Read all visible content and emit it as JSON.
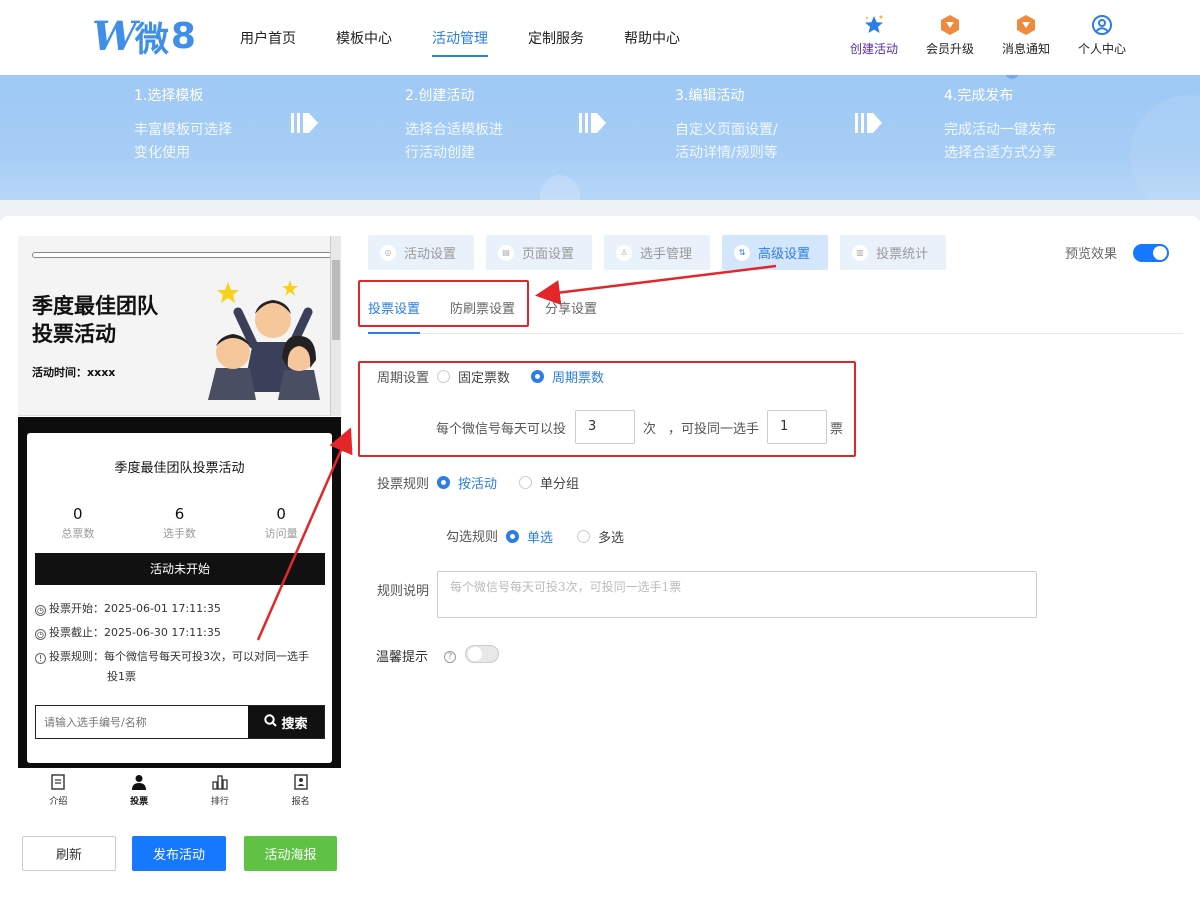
{
  "nav": {
    "logo_w": "W",
    "logo_wei": "微",
    "logo_eight": "8",
    "menu": [
      "用户首页",
      "模板中心",
      "活动管理",
      "定制服务",
      "帮助中心"
    ],
    "active_menu": "活动管理",
    "tools": [
      {
        "label": "创建活动",
        "icon": "star-icon"
      },
      {
        "label": "会员升级",
        "icon": "vip-badge-icon"
      },
      {
        "label": "消息通知",
        "icon": "notification-badge-icon"
      },
      {
        "label": "个人中心",
        "icon": "user-icon"
      }
    ]
  },
  "steps": [
    {
      "title": "1.选择模板",
      "line1": "丰富模板可选择",
      "line2": "变化使用"
    },
    {
      "title": "2.创建活动",
      "line1": "选择合适模板进",
      "line2": "行活动创建"
    },
    {
      "title": "3.编辑活动",
      "line1": "自定义页面设置/",
      "line2": "活动详情/规则等"
    },
    {
      "title": "4.完成发布",
      "line1": "完成活动一键发布",
      "line2": "选择合适方式分享"
    }
  ],
  "phone": {
    "title": "季度最佳团队投票活动",
    "title_line1": "季度最佳团队",
    "title_line2": "投票活动",
    "time_label": "活动时间：xxxx",
    "panel_title": "季度最佳团队投票活动",
    "stats": [
      {
        "value": "0",
        "label": "总票数"
      },
      {
        "value": "6",
        "label": "选手数"
      },
      {
        "value": "0",
        "label": "访问量"
      }
    ],
    "status": "活动未开始",
    "vote_start": "投票开始：2025-06-01 17:11:35",
    "vote_end": "投票截止：2025-06-30 17:11:35",
    "vote_rule_line1": "投票规则：每个微信号每天可投3次，可以对同一选手",
    "vote_rule_line2": "投1票",
    "search_placeholder": "请输入选手编号/名称",
    "search_button": "搜索",
    "tabbar": [
      "介绍",
      "投票",
      "排行",
      "报名"
    ]
  },
  "actions": {
    "refresh": "刷新",
    "publish": "发布活动",
    "poster": "活动海报"
  },
  "main_tabs": [
    "活动设置",
    "页面设置",
    "选手管理",
    "高级设置",
    "投票统计"
  ],
  "active_main_tab": "高级设置",
  "preview": {
    "label": "预览效果",
    "enabled": true
  },
  "sub_tabs": [
    "投票设置",
    "防刷票设置",
    "分享设置"
  ],
  "active_sub_tab": "投票设置",
  "form": {
    "period_label": "周期设置",
    "period_options": [
      "固定票数",
      "周期票数"
    ],
    "period_selected": "周期票数",
    "per_day_prefix": "每个微信号每天可以投",
    "per_day_value": "3",
    "per_day_unit": "次",
    "same_player_prefix": "，可投同一选手",
    "same_player_value": "1",
    "same_player_unit": "票",
    "rule_label": "投票规则",
    "rule_options": [
      "按活动",
      "单分组"
    ],
    "rule_selected": "按活动",
    "check_label": "勾选规则",
    "check_options": [
      "单选",
      "多选"
    ],
    "check_selected": "单选",
    "desc_label": "规则说明",
    "desc_placeholder": "每个微信号每天可投3次，可投同一选手1票",
    "tip_label": "温馨提示",
    "tip_help": "?",
    "tip_enabled": false
  },
  "colors": {
    "accent": "#1677ff",
    "annotation": "#e3262a",
    "poster": "#5fc244"
  }
}
